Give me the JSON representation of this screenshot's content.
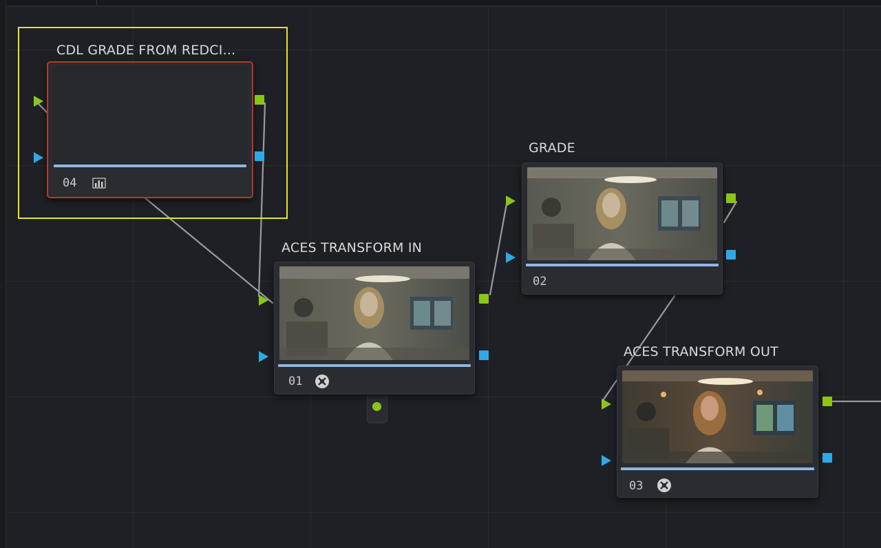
{
  "colors": {
    "background": "#1f2025",
    "node_body": "#2a2c31",
    "selected_border": "#b5372c",
    "selection_frame": "#e9e51e",
    "input_green": "#8ac51a",
    "input_blue": "#2fa8e6",
    "scrub_bar": "#8fb6e3",
    "link": "#9a9ba0"
  },
  "nodes": [
    {
      "title": "CDL GRADE FROM REDCI...",
      "number": "04",
      "icon": "bar-chart-icon",
      "selected": true,
      "has_thumbnail": false
    },
    {
      "title": "ACES TRANSFORM IN",
      "number": "01",
      "icon": "fx-icon",
      "selected": false,
      "has_thumbnail": true
    },
    {
      "title": "GRADE",
      "number": "02",
      "icon": "",
      "selected": false,
      "has_thumbnail": true
    },
    {
      "title": "ACES TRANSFORM OUT",
      "number": "03",
      "icon": "fx-icon",
      "selected": false,
      "has_thumbnail": true
    }
  ]
}
